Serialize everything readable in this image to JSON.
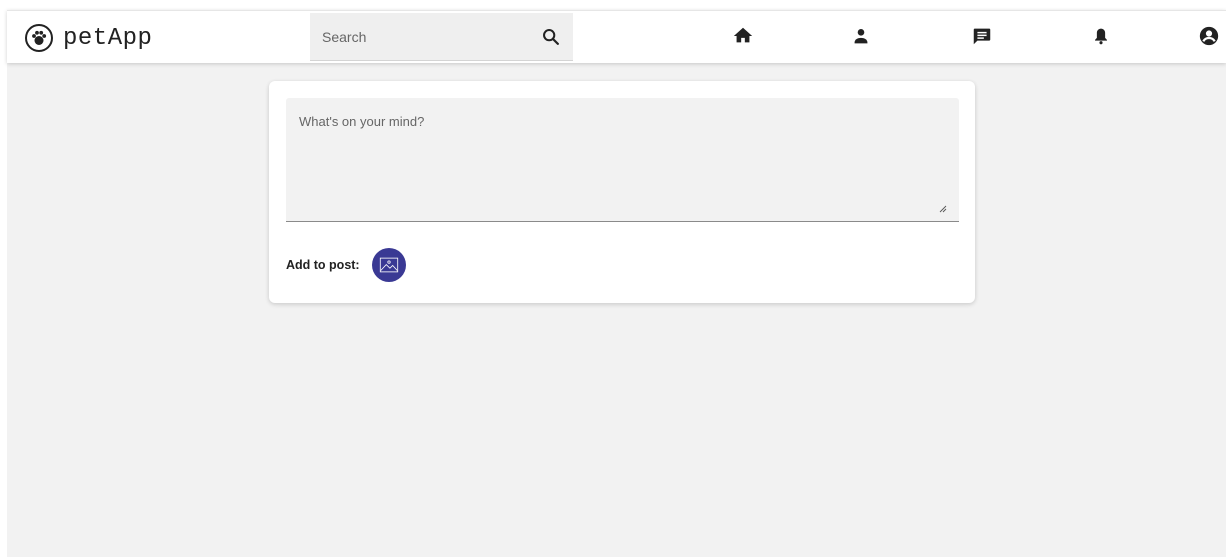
{
  "brand": {
    "name": "petApp",
    "logo_icon": "paw-logo-icon"
  },
  "search": {
    "placeholder": "Search",
    "value": "",
    "icon": "search-icon"
  },
  "nav": {
    "items": [
      {
        "name": "home",
        "icon": "home-icon"
      },
      {
        "name": "profile",
        "icon": "person-icon"
      },
      {
        "name": "messages",
        "icon": "message-icon"
      },
      {
        "name": "notifications",
        "icon": "bell-icon"
      },
      {
        "name": "account",
        "icon": "account-circle-icon"
      }
    ]
  },
  "composer": {
    "placeholder": "What's on your mind?",
    "value": "",
    "add_label": "Add to post:",
    "add_photo_icon": "image-icon"
  },
  "colors": {
    "background": "#f2f2f2",
    "navbar": "#ffffff",
    "accent": "#3a3994",
    "card": "#ffffff"
  }
}
